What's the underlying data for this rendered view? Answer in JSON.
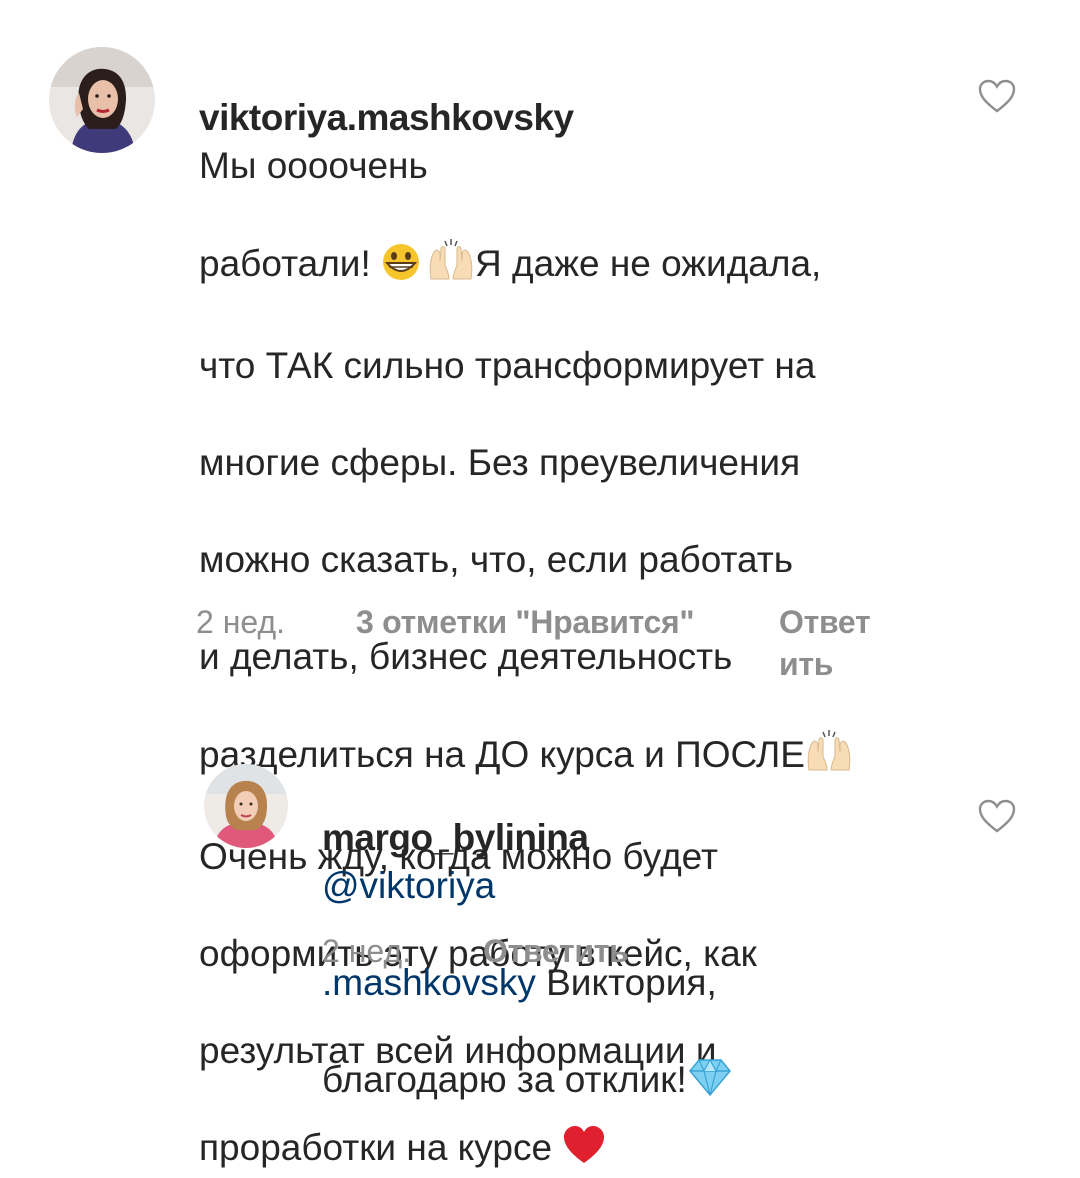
{
  "comments": [
    {
      "username": "viktoriya.mashkovsky",
      "text_parts": [
        "Мы оооочень",
        "работали! ",
        "Я даже не ожидала,",
        "что ТАК сильно  трансформирует на",
        "многие сферы. Без преувеличения",
        "можно сказать, что, если работать",
        "и делать, бизнес деятельность",
        "разделиться на ДО курса и ПОСЛЕ",
        "Очень жду, когда можно будет",
        "оформить эту работу  в кейс, как",
        "результат всей информации и",
        "проработки на курсе "
      ],
      "time": "2 нед.",
      "likes": "3 отметки \"Нравится\"",
      "reply_line1": "Ответ",
      "reply_line2": "ить",
      "icons": {
        "grin": "grinning-face-icon",
        "hands": "raising-hands-icon",
        "heart": "red-heart-icon",
        "like": "heart-outline-icon"
      }
    },
    {
      "username": "margo_bylinina",
      "mention_part1": "@viktoriya",
      "mention_part2": ".mashkovsky",
      "text_after_mention": " Виктория,",
      "text_line3": "благодарю за отклик!",
      "time": "2 нед.",
      "reply": "Ответить",
      "icons": {
        "gem": "gem-stone-icon",
        "like": "heart-outline-icon"
      }
    }
  ],
  "colors": {
    "text": "#262626",
    "meta": "#8e8e8e",
    "mention": "#00376b",
    "heart": "#e0202e"
  }
}
